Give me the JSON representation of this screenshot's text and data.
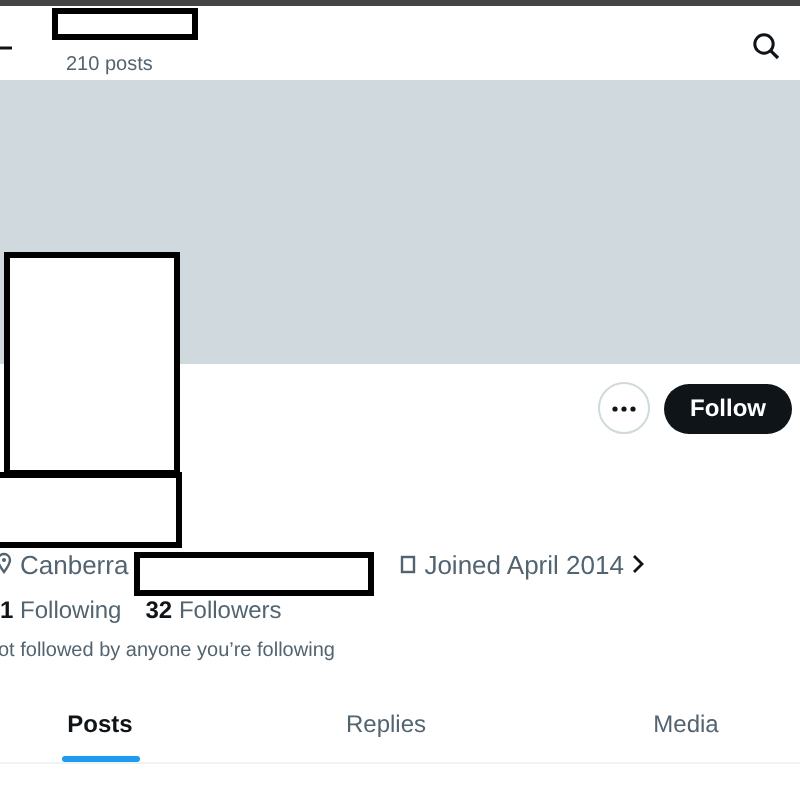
{
  "header": {
    "posts_count": "210 posts"
  },
  "actions": {
    "follow": "Follow"
  },
  "profile": {
    "location": "Canberra",
    "joined": "Joined April 2014",
    "following_count": "1",
    "following_label": "Following",
    "followers_count": "32",
    "followers_label": "Followers",
    "followed_by": "ot followed by anyone you’re following"
  },
  "tabs": [
    {
      "label": "Posts",
      "selected": true
    },
    {
      "label": "Replies",
      "selected": false
    },
    {
      "label": "Media",
      "selected": false
    }
  ]
}
